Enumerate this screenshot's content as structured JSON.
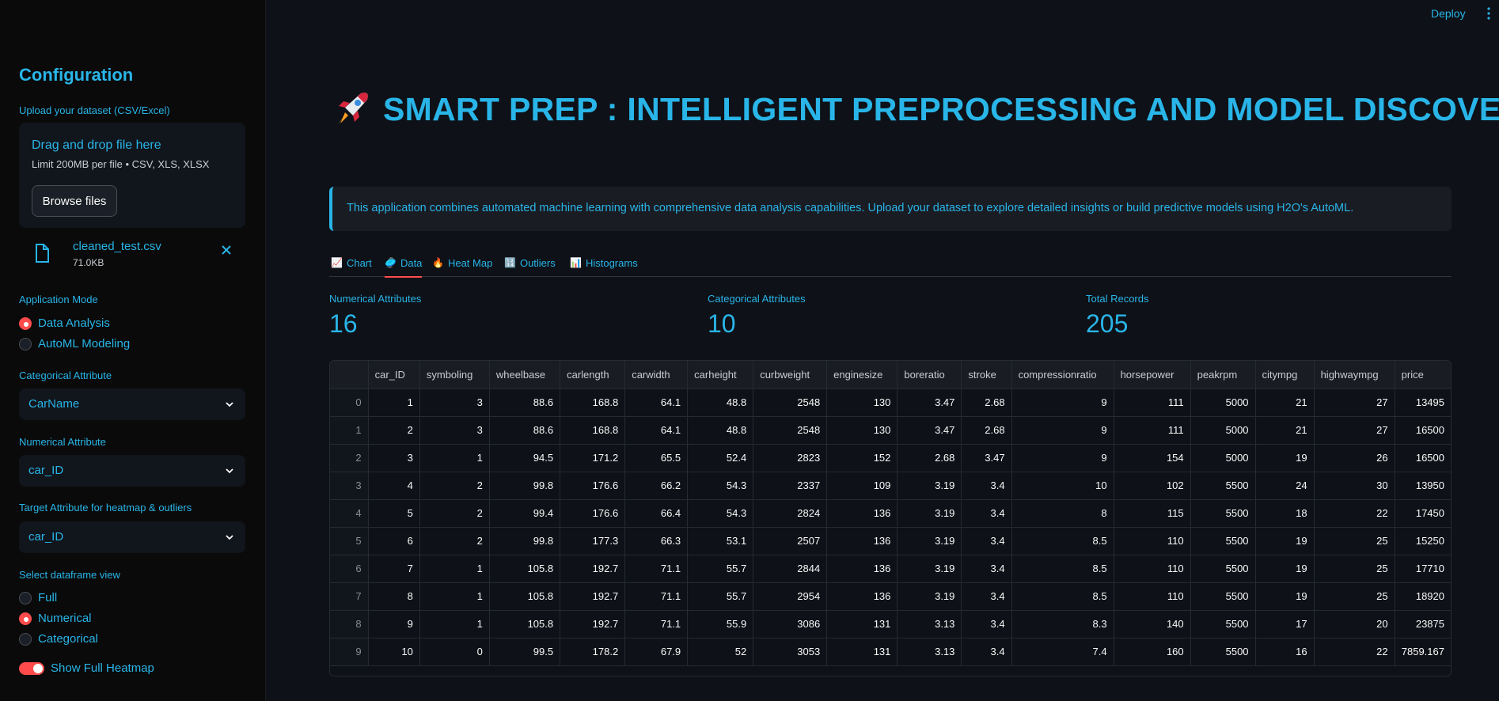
{
  "header": {
    "deploy_label": "Deploy"
  },
  "sidebar": {
    "title": "Configuration",
    "upload_label": "Upload your dataset (CSV/Excel)",
    "dropzone_text": "Drag and drop file here",
    "dropzone_limit": "Limit 200MB per file • CSV, XLS, XLSX",
    "browse_label": "Browse files",
    "file_name": "cleaned_test.csv",
    "file_size": "71.0KB",
    "mode_label": "Application Mode",
    "mode_options": [
      "Data Analysis",
      "AutoML Modeling"
    ],
    "categorical_label": "Categorical Attribute",
    "categorical_value": "CarName",
    "numerical_label": "Numerical Attribute",
    "numerical_value": "car_ID",
    "target_label": "Target Attribute for heatmap & outliers",
    "target_value": "car_ID",
    "view_label": "Select dataframe view",
    "view_options": [
      "Full",
      "Numerical",
      "Categorical"
    ],
    "heatmap_toggle_label": "Show Full Heatmap"
  },
  "main": {
    "title": "SMART PREP : INTELLIGENT PREPROCESSING AND MODEL DISCOVERY",
    "info": "This application combines automated machine learning with comprehensive data analysis capabilities. Upload your dataset to explore detailed insights or build predictive models using H2O's AutoML.",
    "tabs": [
      {
        "icon": "📈",
        "label": "Chart"
      },
      {
        "icon": "🥏",
        "label": "Data"
      },
      {
        "icon": "🔥",
        "label": "Heat Map"
      },
      {
        "icon": "🔢",
        "label": "Outliers"
      },
      {
        "icon": "📊",
        "label": "Histograms"
      }
    ],
    "metrics": [
      {
        "label": "Numerical Attributes",
        "value": "16"
      },
      {
        "label": "Categorical Attributes",
        "value": "10"
      },
      {
        "label": "Total Records",
        "value": "205"
      }
    ]
  },
  "table": {
    "columns": [
      "car_ID",
      "symboling",
      "wheelbase",
      "carlength",
      "carwidth",
      "carheight",
      "curbweight",
      "enginesize",
      "boreratio",
      "stroke",
      "compressionratio",
      "horsepower",
      "peakrpm",
      "citympg",
      "highwaympg",
      "price"
    ],
    "rows": [
      [
        "0",
        "1",
        "3",
        "88.6",
        "168.8",
        "64.1",
        "48.8",
        "2548",
        "130",
        "3.47",
        "2.68",
        "9",
        "111",
        "5000",
        "21",
        "27",
        "13495"
      ],
      [
        "1",
        "2",
        "3",
        "88.6",
        "168.8",
        "64.1",
        "48.8",
        "2548",
        "130",
        "3.47",
        "2.68",
        "9",
        "111",
        "5000",
        "21",
        "27",
        "16500"
      ],
      [
        "2",
        "3",
        "1",
        "94.5",
        "171.2",
        "65.5",
        "52.4",
        "2823",
        "152",
        "2.68",
        "3.47",
        "9",
        "154",
        "5000",
        "19",
        "26",
        "16500"
      ],
      [
        "3",
        "4",
        "2",
        "99.8",
        "176.6",
        "66.2",
        "54.3",
        "2337",
        "109",
        "3.19",
        "3.4",
        "10",
        "102",
        "5500",
        "24",
        "30",
        "13950"
      ],
      [
        "4",
        "5",
        "2",
        "99.4",
        "176.6",
        "66.4",
        "54.3",
        "2824",
        "136",
        "3.19",
        "3.4",
        "8",
        "115",
        "5500",
        "18",
        "22",
        "17450"
      ],
      [
        "5",
        "6",
        "2",
        "99.8",
        "177.3",
        "66.3",
        "53.1",
        "2507",
        "136",
        "3.19",
        "3.4",
        "8.5",
        "110",
        "5500",
        "19",
        "25",
        "15250"
      ],
      [
        "6",
        "7",
        "1",
        "105.8",
        "192.7",
        "71.1",
        "55.7",
        "2844",
        "136",
        "3.19",
        "3.4",
        "8.5",
        "110",
        "5500",
        "19",
        "25",
        "17710"
      ],
      [
        "7",
        "8",
        "1",
        "105.8",
        "192.7",
        "71.1",
        "55.7",
        "2954",
        "136",
        "3.19",
        "3.4",
        "8.5",
        "110",
        "5500",
        "19",
        "25",
        "18920"
      ],
      [
        "8",
        "9",
        "1",
        "105.8",
        "192.7",
        "71.1",
        "55.9",
        "3086",
        "131",
        "3.13",
        "3.4",
        "8.3",
        "140",
        "5500",
        "17",
        "20",
        "23875"
      ],
      [
        "9",
        "10",
        "0",
        "99.5",
        "178.2",
        "67.9",
        "52",
        "3053",
        "131",
        "3.13",
        "3.4",
        "7.4",
        "160",
        "5500",
        "16",
        "22",
        "7859.167"
      ]
    ]
  },
  "colors": {
    "accent": "#29b5e8",
    "primary": "#ff4b4b",
    "background": "#0e1117",
    "sidebar": "#0a0a0a"
  }
}
